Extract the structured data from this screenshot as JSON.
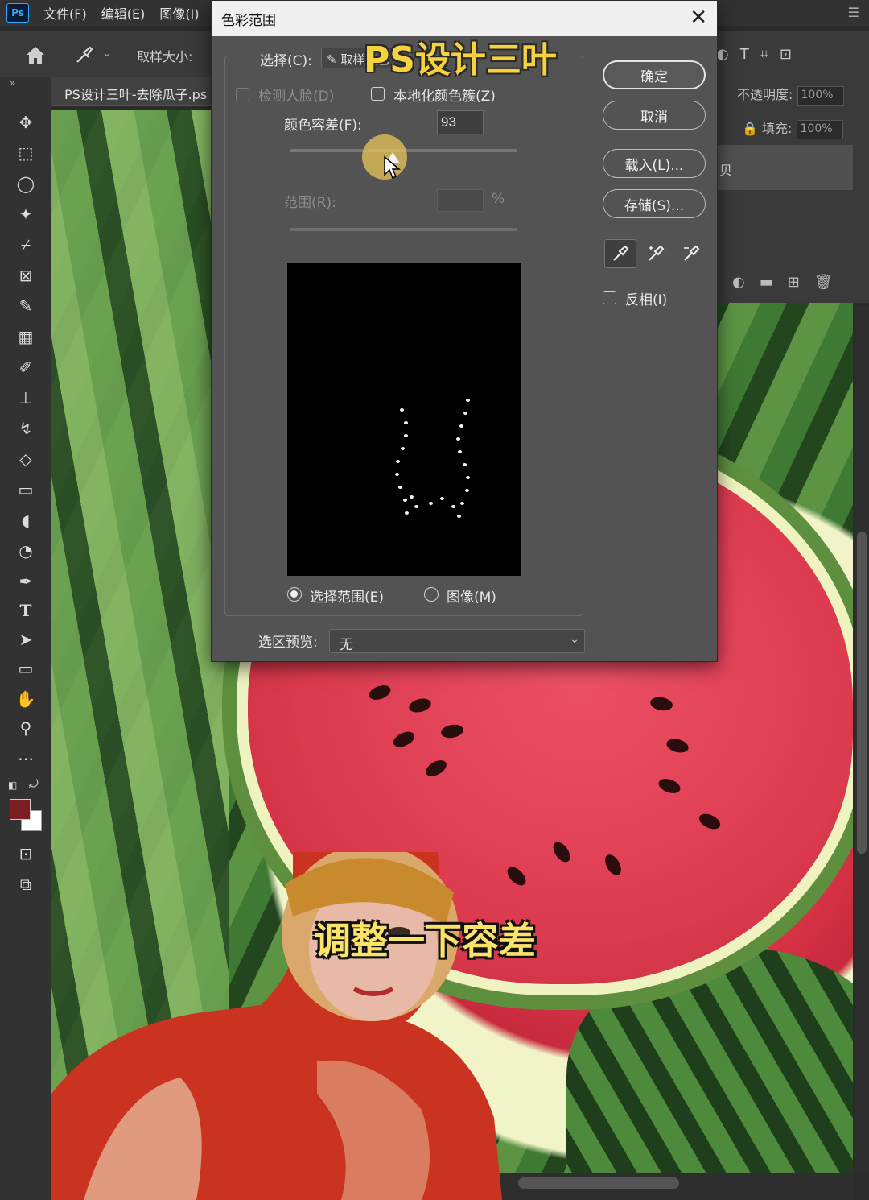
{
  "menubar": {
    "logo": "Ps",
    "items": [
      "文件(F)",
      "编辑(E)",
      "图像(I)"
    ]
  },
  "options_bar": {
    "sample_size_label": "取样大小:"
  },
  "document_tab": {
    "title": "PS设计三叶-去除瓜子.ps"
  },
  "right_panel": {
    "opacity_label": "不透明度:",
    "opacity_value": "100%",
    "fill_label": "填充:",
    "fill_value": "100%",
    "layer_label": "贝"
  },
  "dialog": {
    "title": "色彩范围",
    "select_label": "选择(C):",
    "select_value": "取样颜色",
    "detect_faces_label": "检测人脸(D)",
    "detect_faces_checked": false,
    "localized_clusters_label": "本地化颜色簇(Z)",
    "localized_clusters_checked": false,
    "fuzziness_label": "颜色容差(F):",
    "fuzziness_value": "93",
    "fuzziness_level": 0.45,
    "range_label": "范围(R):",
    "range_unit": "%",
    "radio_selection_label": "选择范围(E)",
    "radio_image_label": "图像(M)",
    "radio_selected": "selection",
    "selection_preview_label": "选区预览:",
    "selection_preview_value": "无",
    "buttons": {
      "ok": "确定",
      "cancel": "取消",
      "load": "载入(L)...",
      "save": "存储(S)..."
    },
    "invert_label": "反相(I)",
    "invert_checked": false
  },
  "overlay": {
    "watermark": "PS设计三叶",
    "subtitle": "调整一下容差"
  },
  "colors": {
    "foreground": "#7a1e22",
    "background": "#ffffff",
    "watermark": "#f6d23d",
    "subtitle": "#fbe36a"
  }
}
